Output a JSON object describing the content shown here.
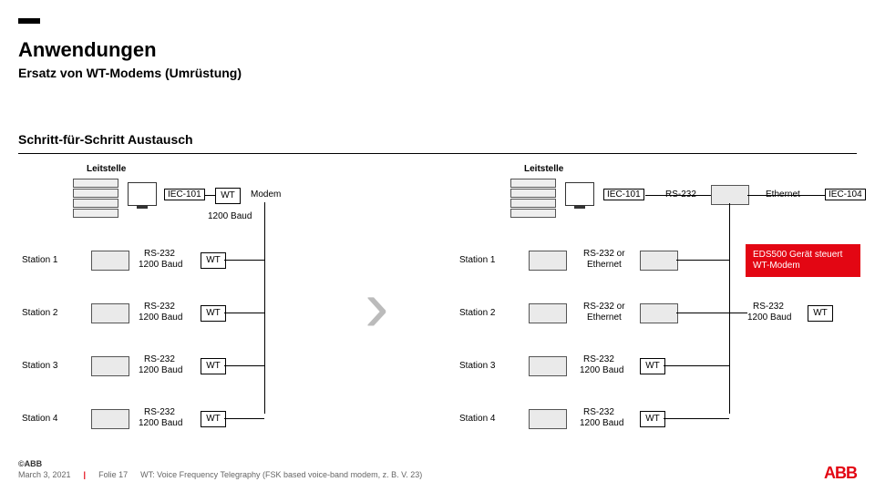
{
  "header": {
    "title": "Anwendungen",
    "subtitle": "Ersatz von WT-Modems (Umrüstung)",
    "section": "Schritt-für-Schritt Austausch"
  },
  "left": {
    "leitstelle": "Leitstelle",
    "iec": "IEC-101",
    "wt": "WT",
    "modem": "Modem",
    "baud": "1200 Baud",
    "stations": [
      {
        "name": "Station 1",
        "proto": "RS-232",
        "rate": "1200 Baud",
        "wt": "WT"
      },
      {
        "name": "Station 2",
        "proto": "RS-232",
        "rate": "1200 Baud",
        "wt": "WT"
      },
      {
        "name": "Station 3",
        "proto": "RS-232",
        "rate": "1200 Baud",
        "wt": "WT"
      },
      {
        "name": "Station 4",
        "proto": "RS-232",
        "rate": "1200 Baud",
        "wt": "WT"
      }
    ]
  },
  "right": {
    "leitstelle": "Leitstelle",
    "iec": "IEC-101",
    "rs232": "RS-232",
    "ethernet": "Ethernet",
    "iec104": "IEC-104",
    "eds_note": "EDS500 Gerät steuert WT-Modem",
    "stations": [
      {
        "name": "Station 1",
        "proto": "RS-232 or",
        "rate": "Ethernet",
        "wt": ""
      },
      {
        "name": "Station 2",
        "proto": "RS-232 or",
        "rate": "Ethernet",
        "wt": "",
        "out_proto": "RS-232",
        "out_rate": "1200 Baud",
        "out_wt": "WT"
      },
      {
        "name": "Station 3",
        "proto": "RS-232",
        "rate": "1200 Baud",
        "wt": "WT"
      },
      {
        "name": "Station 4",
        "proto": "RS-232",
        "rate": "1200 Baud",
        "wt": "WT"
      }
    ]
  },
  "footer": {
    "copyright": "©ABB",
    "date": "March 3, 2021",
    "page": "Folie 17",
    "note": "WT: Voice Frequency Telegraphy (FSK based voice-band modem, z. B. V. 23)",
    "logo": "ABB"
  }
}
